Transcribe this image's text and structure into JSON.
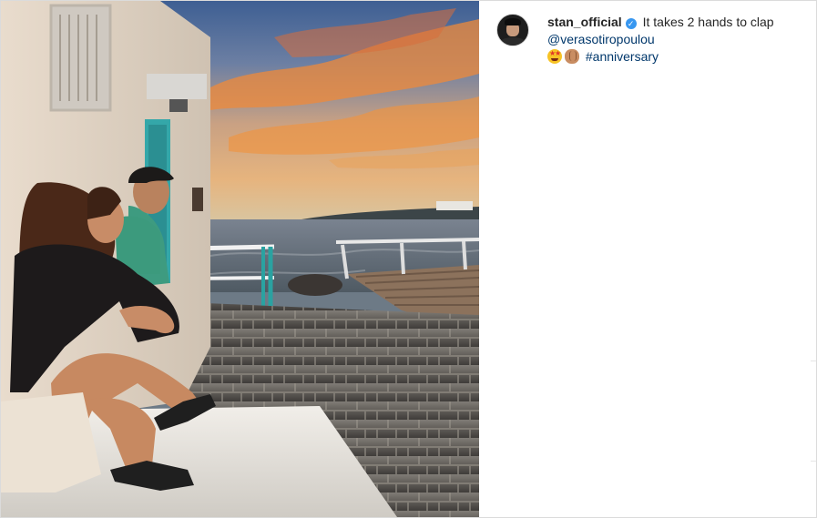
{
  "post": {
    "image_alt": "Couple sitting on a white ledge watching the sunset over the sea",
    "author": {
      "username": "stan_official",
      "verified_badge": "✓",
      "avatar_icon": "avatar"
    },
    "caption": {
      "text": "It takes 2 hands to clap",
      "mention": "@verasotiropoulou",
      "emojis": [
        "star-struck-emoji",
        "clapping-hands-emoji"
      ],
      "hashtag": "#anniversary"
    }
  },
  "colors": {
    "link": "#00376b",
    "verified": "#3897f0",
    "text": "#262626",
    "border": "#dbdbdb"
  }
}
